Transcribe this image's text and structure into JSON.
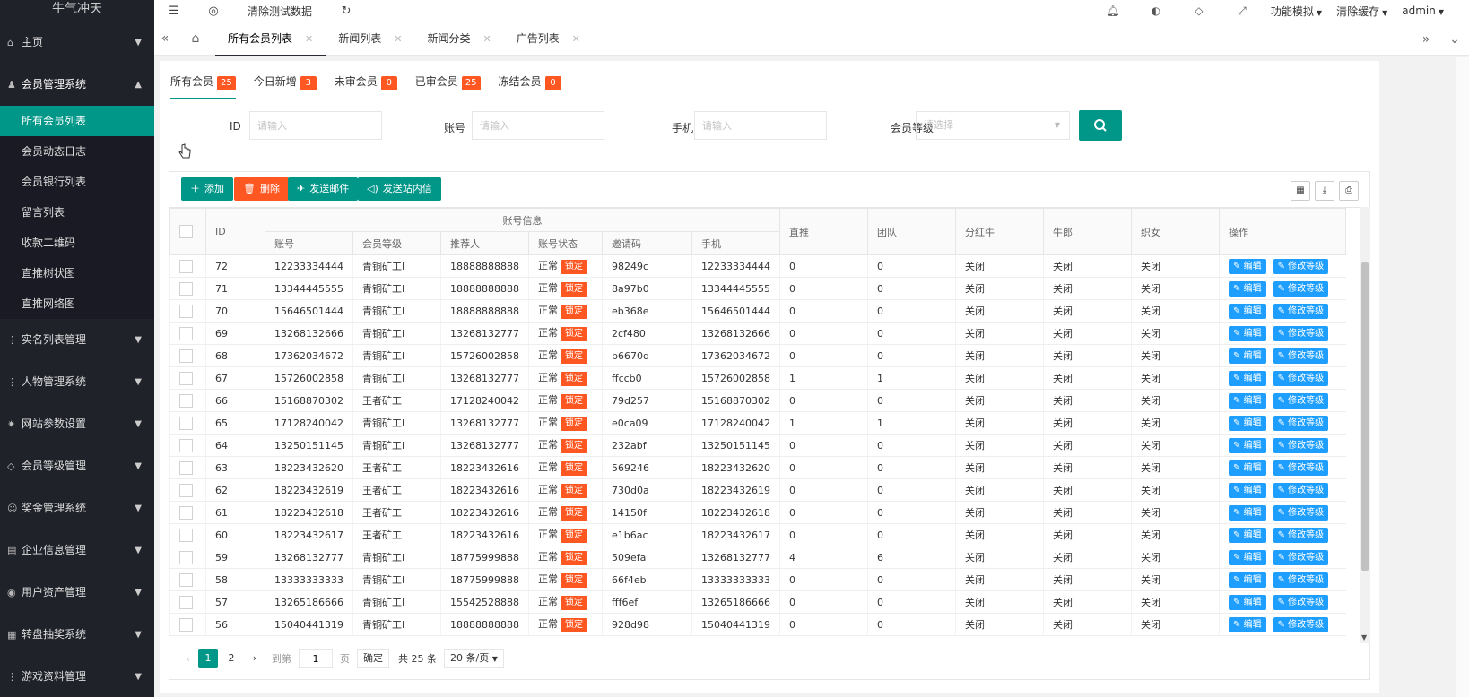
{
  "sidebar": {
    "logo": "牛气冲天",
    "items": [
      {
        "label": "主页",
        "icon": "home-icon",
        "glyph": "⌂"
      },
      {
        "label": "会员管理系统",
        "icon": "users-icon",
        "glyph": "♟",
        "open": true
      },
      {
        "label": "实名列表管理",
        "icon": "list-icon",
        "glyph": "⋮"
      },
      {
        "label": "人物管理系统",
        "icon": "list-icon",
        "glyph": "⋮"
      },
      {
        "label": "网站参数设置",
        "icon": "gear-icon",
        "glyph": "✷"
      },
      {
        "label": "会员等级管理",
        "icon": "diamond-icon",
        "glyph": "◇"
      },
      {
        "label": "奖金管理系统",
        "icon": "smile-icon",
        "glyph": "☺"
      },
      {
        "label": "企业信息管理",
        "icon": "doc-icon",
        "glyph": "▤"
      },
      {
        "label": "用户资产管理",
        "icon": "coin-icon",
        "glyph": "◉"
      },
      {
        "label": "转盘抽奖系统",
        "icon": "grid-icon",
        "glyph": "▦"
      },
      {
        "label": "游戏资料管理",
        "icon": "list-icon",
        "glyph": "⋮"
      }
    ],
    "sub_items": [
      "所有会员列表",
      "会员动态日志",
      "会员银行列表",
      "留言列表",
      "收款二维码",
      "直推树状图",
      "直推网络图"
    ]
  },
  "header": {
    "clear_label": "清除测试数据",
    "function_label": "功能模拟",
    "clear_cache_label": "清除缓存",
    "user_label": "admin"
  },
  "page_tabs": [
    {
      "label": "所有会员列表",
      "active": true
    },
    {
      "label": "新闻列表"
    },
    {
      "label": "新闻分类"
    },
    {
      "label": "广告列表"
    }
  ],
  "member_tabs": [
    {
      "label": "所有会员",
      "count": "25",
      "active": true
    },
    {
      "label": "今日新增",
      "count": "3"
    },
    {
      "label": "未审会员",
      "count": "0"
    },
    {
      "label": "已审会员",
      "count": "25"
    },
    {
      "label": "冻结会员",
      "count": "0"
    }
  ],
  "filters": {
    "id_label": "ID",
    "account_label": "账号",
    "phone_label": "手机",
    "level_label": "会员等级",
    "input_placeholder": "请输入",
    "select_placeholder": "请选择"
  },
  "toolbar": {
    "add": "添加",
    "delete": "删除",
    "send_mail": "发送邮件",
    "send_msg": "发送站内信"
  },
  "table": {
    "group_header": "账号信息",
    "headers": {
      "id": "ID",
      "account": "账号",
      "level": "会员等级",
      "referrer": "推荐人",
      "status": "账号状态",
      "invite": "邀请码",
      "phone": "手机",
      "direct": "直推",
      "team": "团队",
      "bull": "分红牛",
      "herder": "牛郎",
      "weaver": "织女",
      "ops": "操作"
    },
    "lock_label": "锁定",
    "edit_label": "编辑",
    "modify_label": "修改等级",
    "rows": [
      {
        "id": "72",
        "account": "12233334444",
        "level": "青铜矿工I",
        "referrer": "18888888888",
        "status": "正常",
        "invite": "98249c",
        "phone": "12233334444",
        "direct": "0",
        "team": "0",
        "bull": "关闭",
        "herder": "关闭",
        "weaver": "关闭"
      },
      {
        "id": "71",
        "account": "13344445555",
        "level": "青铜矿工I",
        "referrer": "18888888888",
        "status": "正常",
        "invite": "8a97b0",
        "phone": "13344445555",
        "direct": "0",
        "team": "0",
        "bull": "关闭",
        "herder": "关闭",
        "weaver": "关闭"
      },
      {
        "id": "70",
        "account": "15646501444",
        "level": "青铜矿工I",
        "referrer": "18888888888",
        "status": "正常",
        "invite": "eb368e",
        "phone": "15646501444",
        "direct": "0",
        "team": "0",
        "bull": "关闭",
        "herder": "关闭",
        "weaver": "关闭"
      },
      {
        "id": "69",
        "account": "13268132666",
        "level": "青铜矿工I",
        "referrer": "13268132777",
        "status": "正常",
        "invite": "2cf480",
        "phone": "13268132666",
        "direct": "0",
        "team": "0",
        "bull": "关闭",
        "herder": "关闭",
        "weaver": "关闭"
      },
      {
        "id": "68",
        "account": "17362034672",
        "level": "青铜矿工I",
        "referrer": "15726002858",
        "status": "正常",
        "invite": "b6670d",
        "phone": "17362034672",
        "direct": "0",
        "team": "0",
        "bull": "关闭",
        "herder": "关闭",
        "weaver": "关闭"
      },
      {
        "id": "67",
        "account": "15726002858",
        "level": "青铜矿工I",
        "referrer": "13268132777",
        "status": "正常",
        "invite": "ffccb0",
        "phone": "15726002858",
        "direct": "1",
        "team": "1",
        "bull": "关闭",
        "herder": "关闭",
        "weaver": "关闭"
      },
      {
        "id": "66",
        "account": "15168870302",
        "level": "王者矿工",
        "referrer": "17128240042",
        "status": "正常",
        "invite": "79d257",
        "phone": "15168870302",
        "direct": "0",
        "team": "0",
        "bull": "关闭",
        "herder": "关闭",
        "weaver": "关闭"
      },
      {
        "id": "65",
        "account": "17128240042",
        "level": "青铜矿工I",
        "referrer": "13268132777",
        "status": "正常",
        "invite": "e0ca09",
        "phone": "17128240042",
        "direct": "1",
        "team": "1",
        "bull": "关闭",
        "herder": "关闭",
        "weaver": "关闭"
      },
      {
        "id": "64",
        "account": "13250151145",
        "level": "青铜矿工I",
        "referrer": "13268132777",
        "status": "正常",
        "invite": "232abf",
        "phone": "13250151145",
        "direct": "0",
        "team": "0",
        "bull": "关闭",
        "herder": "关闭",
        "weaver": "关闭"
      },
      {
        "id": "63",
        "account": "18223432620",
        "level": "王者矿工",
        "referrer": "18223432616",
        "status": "正常",
        "invite": "569246",
        "phone": "18223432620",
        "direct": "0",
        "team": "0",
        "bull": "关闭",
        "herder": "关闭",
        "weaver": "关闭"
      },
      {
        "id": "62",
        "account": "18223432619",
        "level": "王者矿工",
        "referrer": "18223432616",
        "status": "正常",
        "invite": "730d0a",
        "phone": "18223432619",
        "direct": "0",
        "team": "0",
        "bull": "关闭",
        "herder": "关闭",
        "weaver": "关闭"
      },
      {
        "id": "61",
        "account": "18223432618",
        "level": "王者矿工",
        "referrer": "18223432616",
        "status": "正常",
        "invite": "14150f",
        "phone": "18223432618",
        "direct": "0",
        "team": "0",
        "bull": "关闭",
        "herder": "关闭",
        "weaver": "关闭"
      },
      {
        "id": "60",
        "account": "18223432617",
        "level": "王者矿工",
        "referrer": "18223432616",
        "status": "正常",
        "invite": "e1b6ac",
        "phone": "18223432617",
        "direct": "0",
        "team": "0",
        "bull": "关闭",
        "herder": "关闭",
        "weaver": "关闭"
      },
      {
        "id": "59",
        "account": "13268132777",
        "level": "青铜矿工I",
        "referrer": "18775999888",
        "status": "正常",
        "invite": "509efa",
        "phone": "13268132777",
        "direct": "4",
        "team": "6",
        "bull": "关闭",
        "herder": "关闭",
        "weaver": "关闭"
      },
      {
        "id": "58",
        "account": "13333333333",
        "level": "青铜矿工I",
        "referrer": "18775999888",
        "status": "正常",
        "invite": "66f4eb",
        "phone": "13333333333",
        "direct": "0",
        "team": "0",
        "bull": "关闭",
        "herder": "关闭",
        "weaver": "关闭"
      },
      {
        "id": "57",
        "account": "13265186666",
        "level": "青铜矿工I",
        "referrer": "15542528888",
        "status": "正常",
        "invite": "fff6ef",
        "phone": "13265186666",
        "direct": "0",
        "team": "0",
        "bull": "关闭",
        "herder": "关闭",
        "weaver": "关闭"
      },
      {
        "id": "56",
        "account": "15040441319",
        "level": "青铜矿工I",
        "referrer": "18888888888",
        "status": "正常",
        "invite": "928d98",
        "phone": "15040441319",
        "direct": "0",
        "team": "0",
        "bull": "关闭",
        "herder": "关闭",
        "weaver": "关闭"
      }
    ]
  },
  "pagination": {
    "pages": [
      "1",
      "2"
    ],
    "goto_label": "到第",
    "page_value": "1",
    "page_unit": "页",
    "confirm_label": "确定",
    "total_label": "共 25 条",
    "page_size_label": "20 条/页"
  },
  "colors": {
    "primary": "#009688",
    "danger": "#ff5722",
    "info": "#1e9fff",
    "sidebar": "#20222a"
  }
}
